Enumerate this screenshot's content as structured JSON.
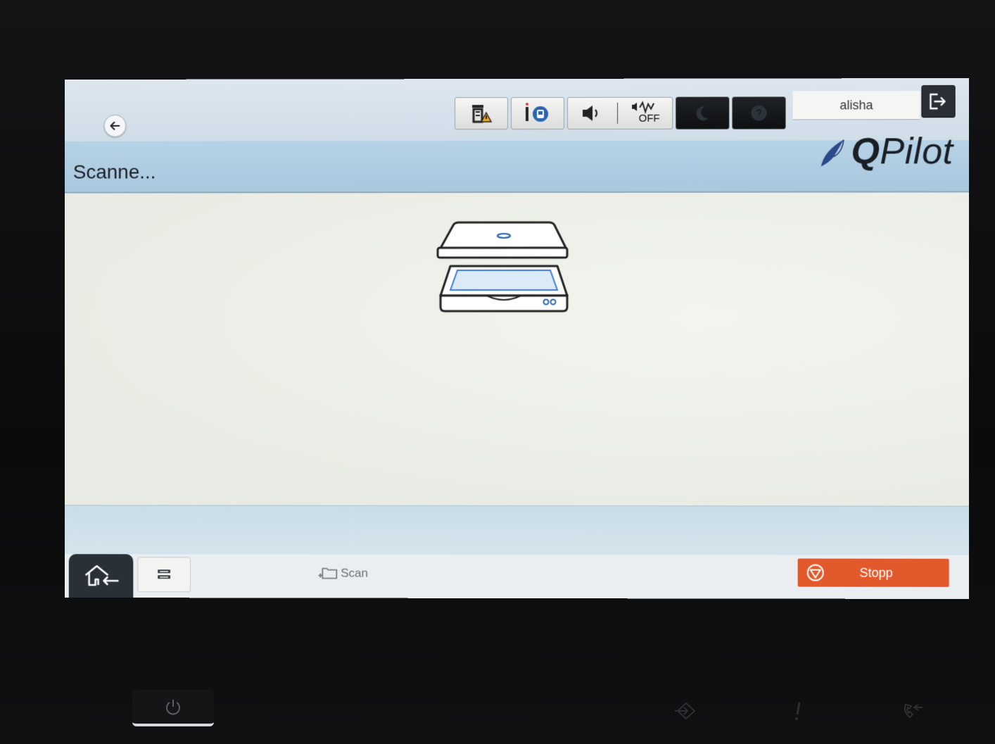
{
  "header": {
    "user_name": "alisha",
    "status_icons": [
      "supplies-warning-icon",
      "device-info-icon",
      "volume-icon",
      "noise-off-icon",
      "sleep-moon-icon",
      "help-icon"
    ],
    "noise_off_label": "OFF"
  },
  "title": {
    "page_title": "Scanne...",
    "brand_prefix": "Q",
    "brand_suffix": "Pilot"
  },
  "bottom": {
    "task_label": "Scan",
    "stop_label": "Stopp"
  },
  "colors": {
    "accent_stop": "#e2592b",
    "title_band": "#b6d2e6",
    "brand_leaf": "#2b4a8a"
  }
}
